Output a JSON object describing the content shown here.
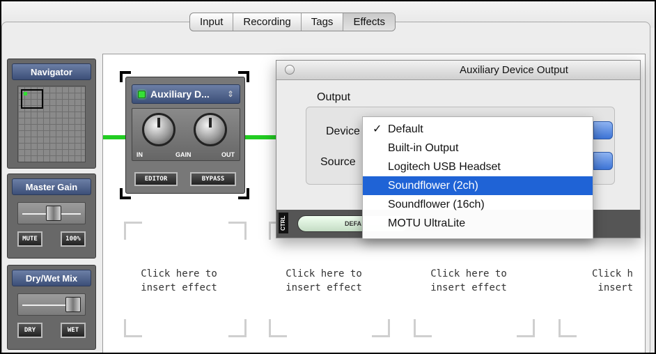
{
  "tabs": [
    {
      "label": "Input"
    },
    {
      "label": "Recording"
    },
    {
      "label": "Tags"
    },
    {
      "label": "Effects",
      "active": true
    }
  ],
  "sidebar": {
    "navigator": {
      "title": "Navigator"
    },
    "master_gain": {
      "title": "Master Gain",
      "mute_label": "MUTE",
      "percent_label": "100%"
    },
    "dry_wet": {
      "title": "Dry/Wet Mix",
      "dry_label": "DRY",
      "wet_label": "WET"
    }
  },
  "plugin": {
    "name": "Auxiliary D...",
    "in_label": "IN",
    "gain_label": "GAIN",
    "out_label": "OUT",
    "editor_label": "EDITOR",
    "bypass_label": "BYPASS",
    "led_color": "#36e036"
  },
  "slots": [
    {
      "line1": "Click here to",
      "line2": "insert effect"
    },
    {
      "line1": "Click here to",
      "line2": "insert effect"
    },
    {
      "line1": "Click here to",
      "line2": "insert effect"
    },
    {
      "line1": "Click h",
      "line2": "insert"
    }
  ],
  "dialog": {
    "title": "Auxiliary Device Output",
    "group_label": "Output",
    "device_label": "Device",
    "source_label": "Source",
    "ctrl_label": "CTRL",
    "ctrl_pill_text": "DEFA"
  },
  "menu": {
    "items": [
      {
        "label": "Default",
        "checked": true
      },
      {
        "label": "Built-in Output"
      },
      {
        "label": "Logitech USB Headset"
      },
      {
        "label": "Soundflower (2ch)",
        "highlighted": true
      },
      {
        "label": "Soundflower (16ch)"
      },
      {
        "label": "MOTU UltraLite"
      }
    ],
    "check_glyph": "✓",
    "highlight_color": "#1f63d6"
  },
  "accent": {
    "wire_color": "#22cc22",
    "panel_title_color": "#4a5d88"
  }
}
